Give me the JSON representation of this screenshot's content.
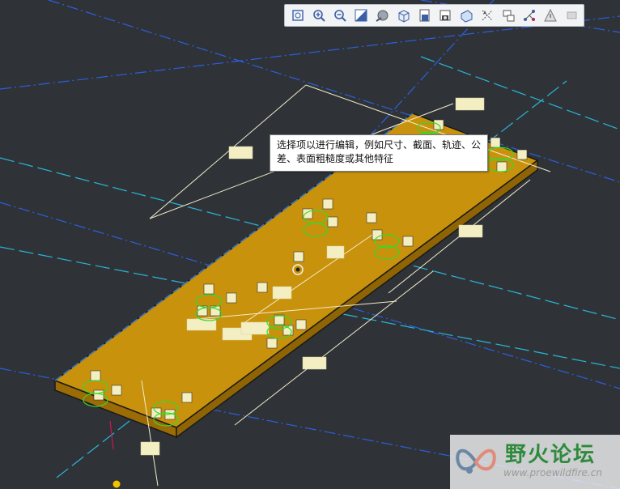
{
  "toolbar": {
    "buttons": [
      {
        "id": "refit",
        "icon": "zoom-fit-icon"
      },
      {
        "id": "zoom-in",
        "icon": "zoom-in-icon"
      },
      {
        "id": "zoom-out",
        "icon": "zoom-out-icon"
      },
      {
        "id": "repaint",
        "icon": "repaint-icon"
      },
      {
        "id": "shading",
        "icon": "shading-icon"
      },
      {
        "id": "display-style",
        "icon": "display-style-icon"
      },
      {
        "id": "saved-views",
        "icon": "saved-views-icon"
      },
      {
        "id": "view-manager",
        "icon": "view-manager-icon"
      },
      {
        "id": "perspective",
        "icon": "perspective-icon"
      },
      {
        "id": "datum-display",
        "icon": "datum-display-icon"
      },
      {
        "id": "annotation-display",
        "icon": "annotation-display-icon"
      },
      {
        "id": "spin-center",
        "icon": "spin-center-icon"
      },
      {
        "id": "triad",
        "icon": "triad-icon"
      },
      {
        "id": "appearance",
        "icon": "appearance-icon"
      }
    ]
  },
  "tooltip": {
    "text": "选择项以进行编辑，例如尺寸、截面、轨迹、公差、表面粗糙度或其他特征"
  },
  "watermark": {
    "name": "野火论坛",
    "url": "www.proewildfire.cn"
  },
  "colors": {
    "background": "#2f3337",
    "plate_top": "#c9920c",
    "plate_side": "#a47306",
    "plate_edge": "#1a1a1a",
    "dimension_line": "#f1ebc8",
    "dimension_box": "#f4efc2",
    "hole_green": "#36d92c",
    "axis_cyan": "#29b6d8",
    "datum_blue": "#2c5fe0",
    "watermark_green": "#2f8a3e"
  }
}
